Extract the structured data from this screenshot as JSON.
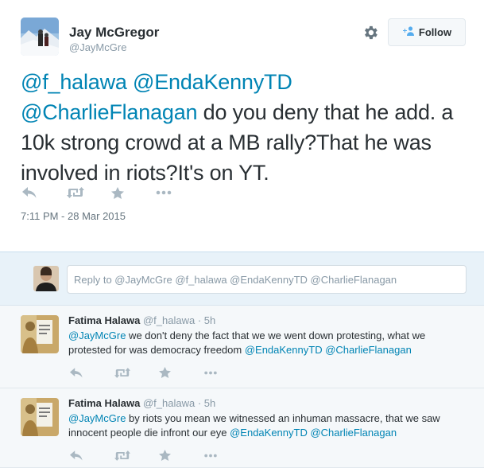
{
  "tweet": {
    "author_name": "Jay McGregor",
    "author_handle": "@JayMcGre",
    "follow_label": "Follow",
    "text_parts": [
      {
        "text": "@f_halawa",
        "mention": true
      },
      {
        "text": " ",
        "mention": false
      },
      {
        "text": "@EndaKennyTD",
        "mention": true
      },
      {
        "text": " ",
        "mention": false
      },
      {
        "text": "@CharlieFlanagan",
        "mention": true
      },
      {
        "text": " do you deny that he add. a 10k strong crowd at a MB rally?That he was involved in riots?It's on YT.",
        "mention": false
      }
    ],
    "timestamp": "7:11 PM - 28 Mar 2015"
  },
  "icons": {
    "gear": "gear-icon",
    "follow": "add-user-icon",
    "reply": "reply-icon",
    "retweet": "retweet-icon",
    "favorite": "star-icon",
    "more": "more-icon"
  },
  "reply_box": {
    "placeholder": "Reply to @JayMcGre @f_halawa @EndaKennyTD @CharlieFlanagan"
  },
  "replies": [
    {
      "name": "Fatima Halawa",
      "handle": "@f_halawa",
      "time": "5h",
      "text_parts": [
        {
          "text": "@JayMcGre",
          "mention": true
        },
        {
          "text": " we don't deny the fact that we we went down protesting, what we protested for was democracy freedom ",
          "mention": false
        },
        {
          "text": "@EndaKennyTD",
          "mention": true
        },
        {
          "text": " ",
          "mention": false
        },
        {
          "text": "@CharlieFlanagan",
          "mention": true
        }
      ]
    },
    {
      "name": "Fatima Halawa",
      "handle": "@f_halawa",
      "time": "5h",
      "text_parts": [
        {
          "text": "@JayMcGre",
          "mention": true
        },
        {
          "text": " by riots you mean we witnessed an inhuman massacre, that we saw innocent people die infront our eye ",
          "mention": false
        },
        {
          "text": "@EndaKennyTD",
          "mention": true
        },
        {
          "text": " ",
          "mention": false
        },
        {
          "text": "@CharlieFlanagan",
          "mention": true
        }
      ]
    }
  ],
  "colors": {
    "link": "#0084b4",
    "icon_gray": "#aab8c2",
    "reply_bg": "#e8f2f9"
  }
}
